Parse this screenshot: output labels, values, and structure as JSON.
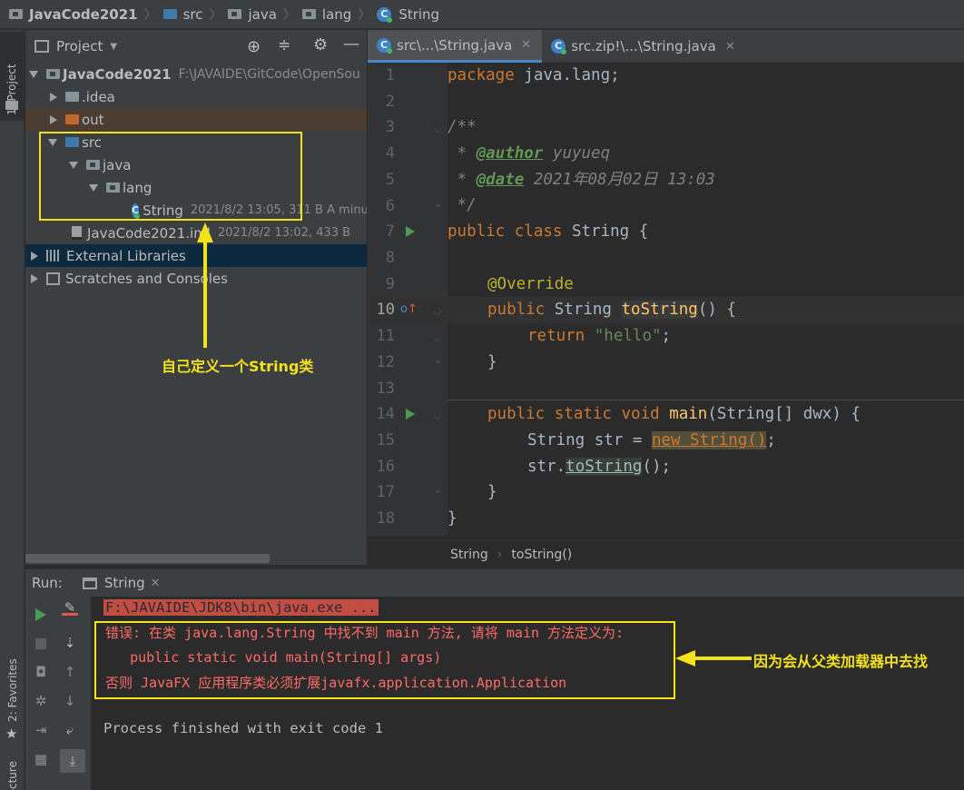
{
  "breadcrumb": {
    "project": "JavaCode2021",
    "items": [
      "src",
      "java",
      "lang",
      "String"
    ]
  },
  "left_stripe": {
    "project_label": "1: Project",
    "favorites_label": "2: Favorites",
    "structure_label": "cture"
  },
  "project_panel": {
    "title": "Project",
    "root": {
      "name": "JavaCode2021",
      "path": "F:\\JAVAIDE\\GitCode\\OpenSou"
    },
    "nodes": [
      {
        "name": ".idea"
      },
      {
        "name": "out"
      },
      {
        "name": "src"
      },
      {
        "name": "java"
      },
      {
        "name": "lang"
      },
      {
        "name": "String",
        "meta": "2021/8/2 13:05, 311 B A minu"
      },
      {
        "name": "JavaCode2021.iml",
        "meta": "2021/8/2 13:02, 433 B"
      },
      {
        "name": "External Libraries"
      },
      {
        "name": "Scratches and Consoles"
      }
    ],
    "annotation": "自己定义一个String类"
  },
  "editor": {
    "tabs": [
      {
        "label": "src\\...\\String.java"
      },
      {
        "label": "src.zip!\\...\\String.java"
      }
    ],
    "line_numbers": [
      "1",
      "2",
      "3",
      "4",
      "5",
      "6",
      "7",
      "8",
      "9",
      "10",
      "11",
      "12",
      "13",
      "14",
      "15",
      "16",
      "17",
      "18"
    ],
    "code": {
      "l1_kw": "package",
      "l1_rest": " java.lang;",
      "l3": "/**",
      "l4_pre": " * ",
      "l4_tag": "@author",
      "l4_val": " yuyueq",
      "l5_pre": " * ",
      "l5_tag": "@date",
      "l5_val": " 2021年08月02日 13:03",
      "l6": " */",
      "l7_kw": "public class",
      "l7_rest": " String {",
      "l9": "@Override",
      "l10_kw": "public",
      "l10_mid": " String ",
      "l10_fn": "toString",
      "l10_rest": "() {",
      "l11_kw": "return",
      "l11_str": "\"hello\"",
      "l11_end": ";",
      "l12": "}",
      "l14_kw": "public static void",
      "l14_fn": "main",
      "l14_rest": "(String[] dwx) {",
      "l15_pre": "String str = ",
      "l15_new": "new String()",
      "l15_end": ";",
      "l16_pre": "str.",
      "l16_call": "toString",
      "l16_end": "();",
      "l17": "}",
      "l18": "}"
    },
    "status_crumbs": [
      "String",
      "toString()"
    ]
  },
  "run_panel": {
    "label": "Run:",
    "tab": "String",
    "lines": {
      "cmd": "F:\\JAVAIDE\\JDK8\\bin\\java.exe ...",
      "err1": "错误: 在类 java.lang.String 中找不到 main 方法, 请将 main 方法定义为:",
      "err2": "   public static void main(String[] args)",
      "err3": "否则 JavaFX 应用程序类必须扩展javafx.application.Application",
      "exit": "Process finished with exit code 1"
    },
    "annotation": "因为会从父类加载器中去找"
  },
  "colors": {
    "highlight_yellow": "#f3e21b",
    "error_red": "#ff6b68",
    "keyword": "#cc7832"
  }
}
